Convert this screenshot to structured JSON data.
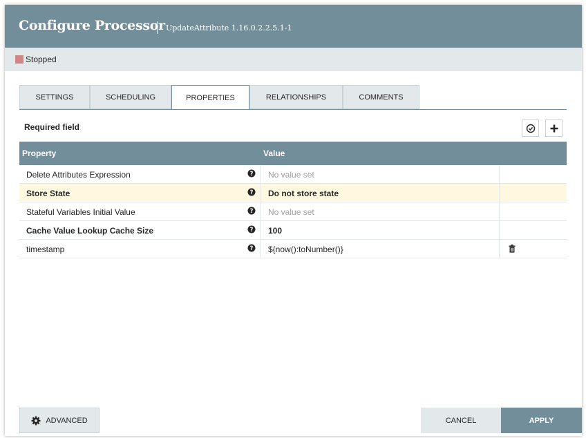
{
  "dialog": {
    "title": "Configure Processor",
    "subtitle": "UpdateAttribute 1.16.0.2.2.5.1-1"
  },
  "status": {
    "text": "Stopped",
    "color": "#d18686"
  },
  "tabs": [
    {
      "label": "SETTINGS",
      "active": false
    },
    {
      "label": "SCHEDULING",
      "active": false
    },
    {
      "label": "PROPERTIES",
      "active": true
    },
    {
      "label": "RELATIONSHIPS",
      "active": false
    },
    {
      "label": "COMMENTS",
      "active": false
    }
  ],
  "properties": {
    "required_label": "Required field",
    "columns": [
      "Property",
      "Value"
    ],
    "rows": [
      {
        "name": "Delete Attributes Expression",
        "value": "No value set",
        "required": false,
        "empty": true
      },
      {
        "name": "Store State",
        "value": "Do not store state",
        "required": true,
        "empty": false
      },
      {
        "name": "Stateful Variables Initial Value",
        "value": "No value set",
        "required": false,
        "empty": true
      },
      {
        "name": "Cache Value Lookup Cache Size",
        "value": "100",
        "required": true,
        "empty": false
      },
      {
        "name": "timestamp",
        "value": "${now():toNumber()}",
        "required": false,
        "empty": false,
        "deletable": true
      }
    ]
  },
  "footer": {
    "advanced_label": "ADVANCED",
    "cancel_label": "CANCEL",
    "apply_label": "APPLY"
  },
  "colors": {
    "header": "#728e9b",
    "status_bar": "#e3e8eb",
    "highlight_row": "#fff8e1"
  },
  "icons": {
    "verify": "check-circle-icon",
    "add": "plus-icon",
    "help": "question-circle-icon",
    "delete": "trash-icon",
    "advanced": "gear-icon"
  }
}
